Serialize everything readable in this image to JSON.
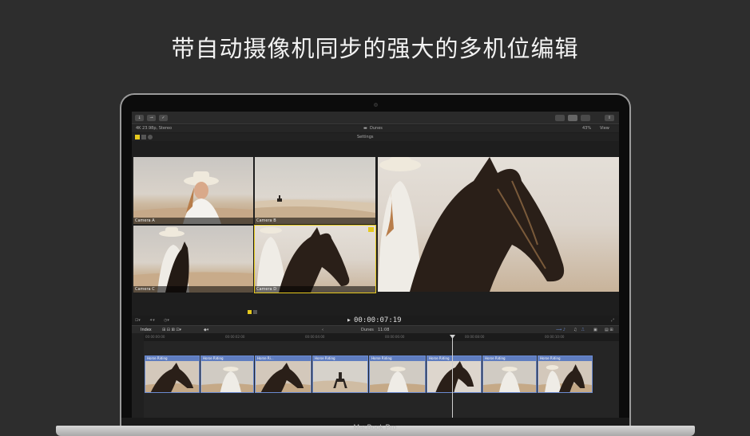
{
  "hero": {
    "title": "带自动摄像机同步的强大的多机位编辑"
  },
  "device": {
    "brand": "MacBook Pro"
  },
  "app": {
    "project_format": "4K 23.98p, Stereo",
    "project_name": "Dunes",
    "zoom": "43%",
    "view_label": "View",
    "settings_label": "Settings",
    "angles": [
      {
        "label": "Camera A"
      },
      {
        "label": "Camera B"
      },
      {
        "label": "Camera C"
      },
      {
        "label": "Camera D"
      }
    ],
    "timecode": "00:00:07:19",
    "timeline": {
      "index_label": "Index",
      "name": "Dunes",
      "duration": "11:08",
      "clip_name": "Horse Riding",
      "clip_name_short": "Horse Ri...",
      "ruler_marks": [
        "00:00:00:00",
        "00:00:02:00",
        "00:00:04:00",
        "00:00:06:00",
        "00:00:08:00",
        "00:00:10:00"
      ]
    }
  },
  "colors": {
    "selection": "#e5c91e",
    "clip": "#5f7dc0",
    "background": "#2d2d2d"
  }
}
